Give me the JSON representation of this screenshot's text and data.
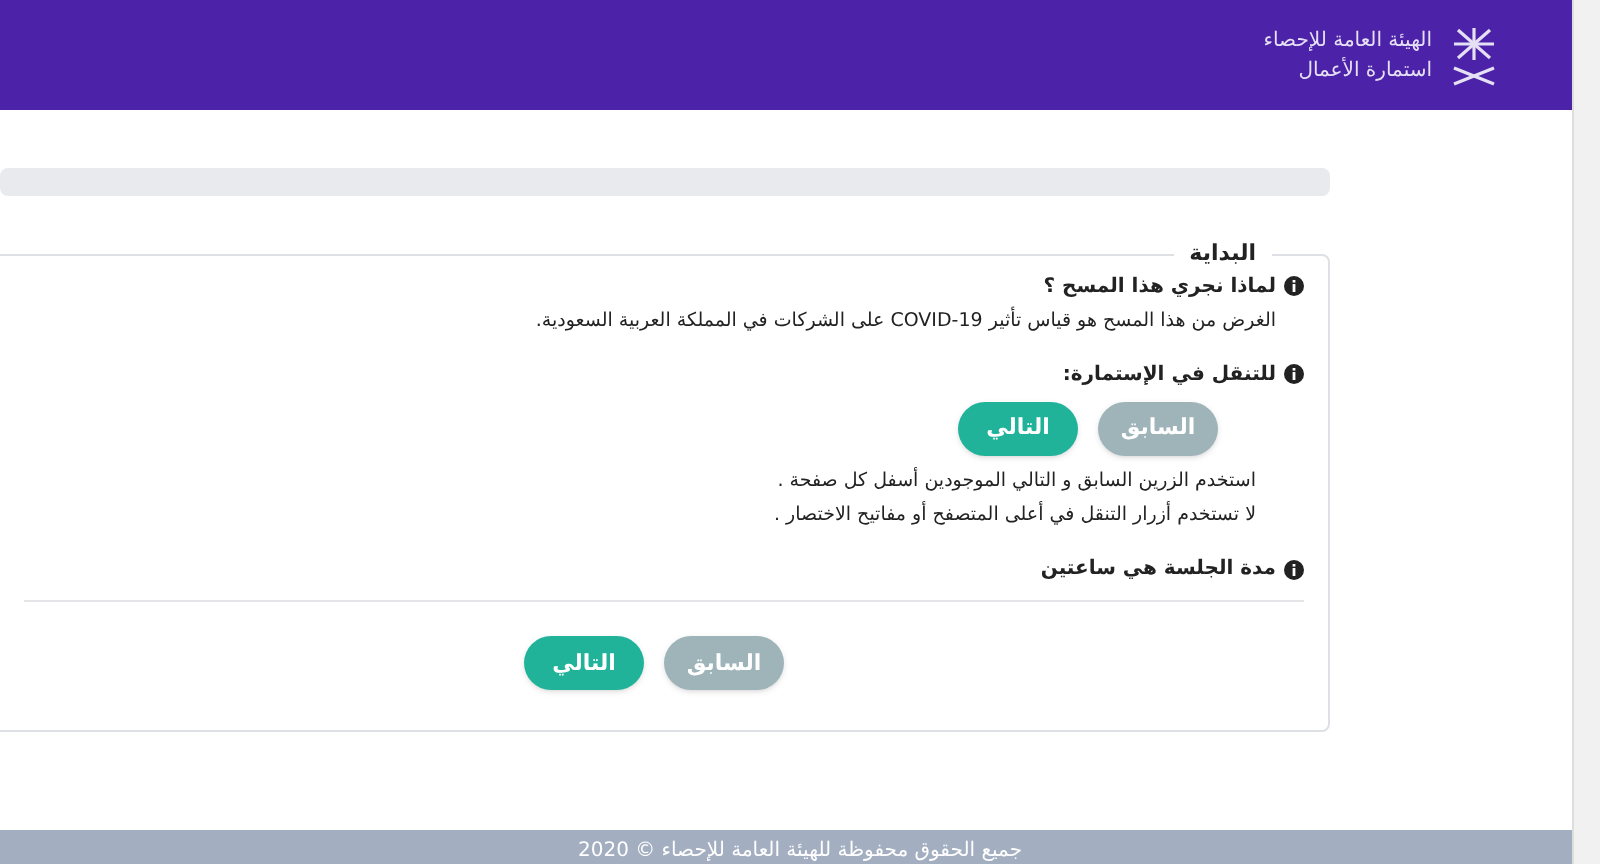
{
  "header": {
    "org_name": "الهيئة العامة للإحصاء",
    "subtitle": "استمارة الأعمال"
  },
  "section": {
    "legend": "البداية",
    "items": [
      {
        "title": "لماذا نجري هذا المسح ؟",
        "lines": [
          "الغرض من هذا المسح هو قياس تأثير COVID-19 على الشركات في المملكة العربية السعودية."
        ]
      },
      {
        "title": "للتنقل في الإستمارة:",
        "buttons": [
          {
            "label": "السابق",
            "disabled": true
          },
          {
            "label": "التالي",
            "disabled": false
          }
        ],
        "lines": [
          "استخدم الزرين السابق و التالي الموجودين أسفل كل صفحة .",
          "لا تستخدم أزرار التنقل في أعلى المتصفح أو مفاتيح الاختصار ."
        ]
      },
      {
        "title": "مدة الجلسة هي ساعتين"
      }
    ],
    "buttons": [
      {
        "label": "السابق",
        "disabled": true
      },
      {
        "label": "التالي",
        "disabled": false
      }
    ]
  },
  "footer": {
    "text": "جميع الحقوق محفوظة للهيئة العامة للإحصاء © 2020"
  }
}
